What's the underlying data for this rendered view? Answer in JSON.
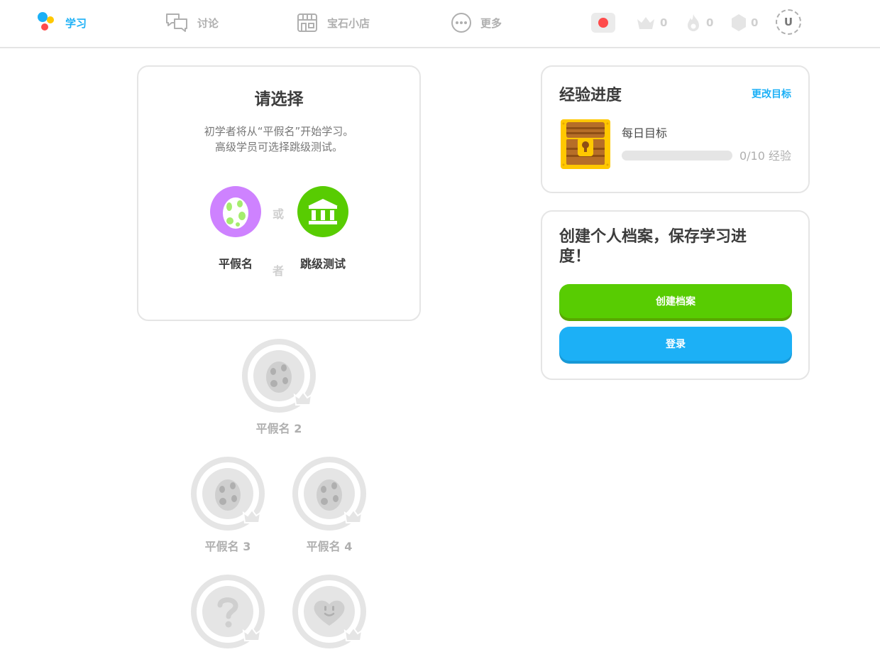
{
  "nav": {
    "items": [
      {
        "label": "学习",
        "icon": "learn-icon",
        "active": true
      },
      {
        "label": "讨论",
        "icon": "discuss-icon",
        "active": false
      },
      {
        "label": "宝石小店",
        "icon": "shop-icon",
        "active": false
      },
      {
        "label": "更多",
        "icon": "more-icon",
        "active": false
      }
    ],
    "flag": "red-flag-icon",
    "crowns": "0",
    "streak": "0",
    "gems": "0",
    "avatar": "U"
  },
  "choose": {
    "title": "请选择",
    "desc_line1": "初学者将从“平假名”开始学习。",
    "desc_line2": "高级学员可选择跳级测试。",
    "option1": "平假名",
    "option2": "跳级测试",
    "or_top": "或",
    "or_bottom": "者"
  },
  "xp": {
    "title": "经验进度",
    "edit": "更改目标",
    "goal_label": "每日目标",
    "progress_text": "0/10 经验",
    "progress_fraction": 0
  },
  "profile": {
    "title": "创建个人档案，保存学习进度！",
    "create": "创建档案",
    "login": "登录"
  },
  "skills": [
    {
      "label": "平假名 2",
      "icon": "egg-icon"
    },
    {
      "label": "平假名 3",
      "icon": "egg-icon"
    },
    {
      "label": "平假名 4",
      "icon": "egg-icon"
    },
    {
      "label": "",
      "icon": "question-icon"
    },
    {
      "label": "",
      "icon": "heart-face-icon"
    }
  ],
  "colors": {
    "accent": "#1cb0f6",
    "green": "#58cc02",
    "purple": "#ce82ff",
    "locked": "#e5e5e5"
  }
}
